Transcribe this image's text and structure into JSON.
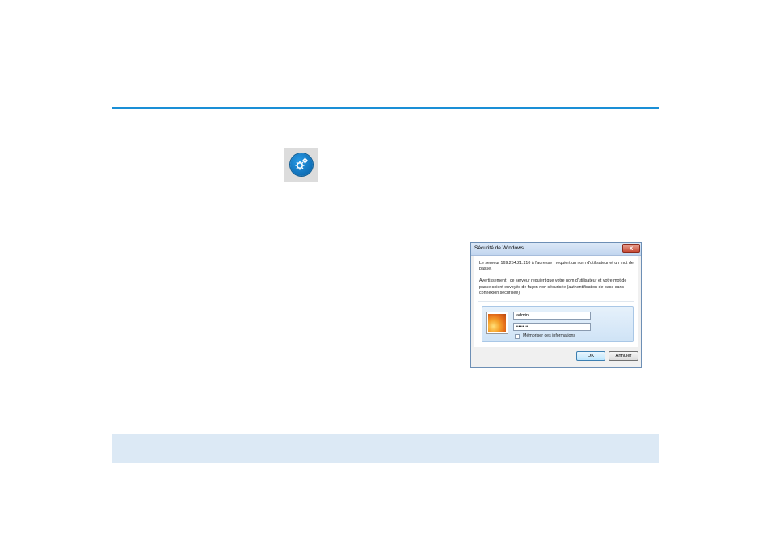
{
  "dialog": {
    "title": "Sécurité de Windows",
    "close_glyph": "x",
    "message": "Le serveur 169.254.21.210 à l'adresse : requiert un nom d'utilisateur et un mot de passe.",
    "warning": "Avertissement : ce serveur requiert que votre nom d'utilisateur et votre mot de passe soient envoyés de façon non sécurisée (authentification de base sans connexion sécurisée).",
    "username_value": "admin",
    "password_value": "••••••",
    "remember_label": "Mémoriser ces informations",
    "ok_label": "OK",
    "cancel_label": "Annuler"
  },
  "icons": {
    "settings": "gear-icon",
    "close": "close-icon",
    "user_picture": "user-picture-icon"
  },
  "colors": {
    "accent_rule": "#1a8fd6",
    "bottom_band": "#dce9f5",
    "gear_blue": "#0f6fb7"
  }
}
